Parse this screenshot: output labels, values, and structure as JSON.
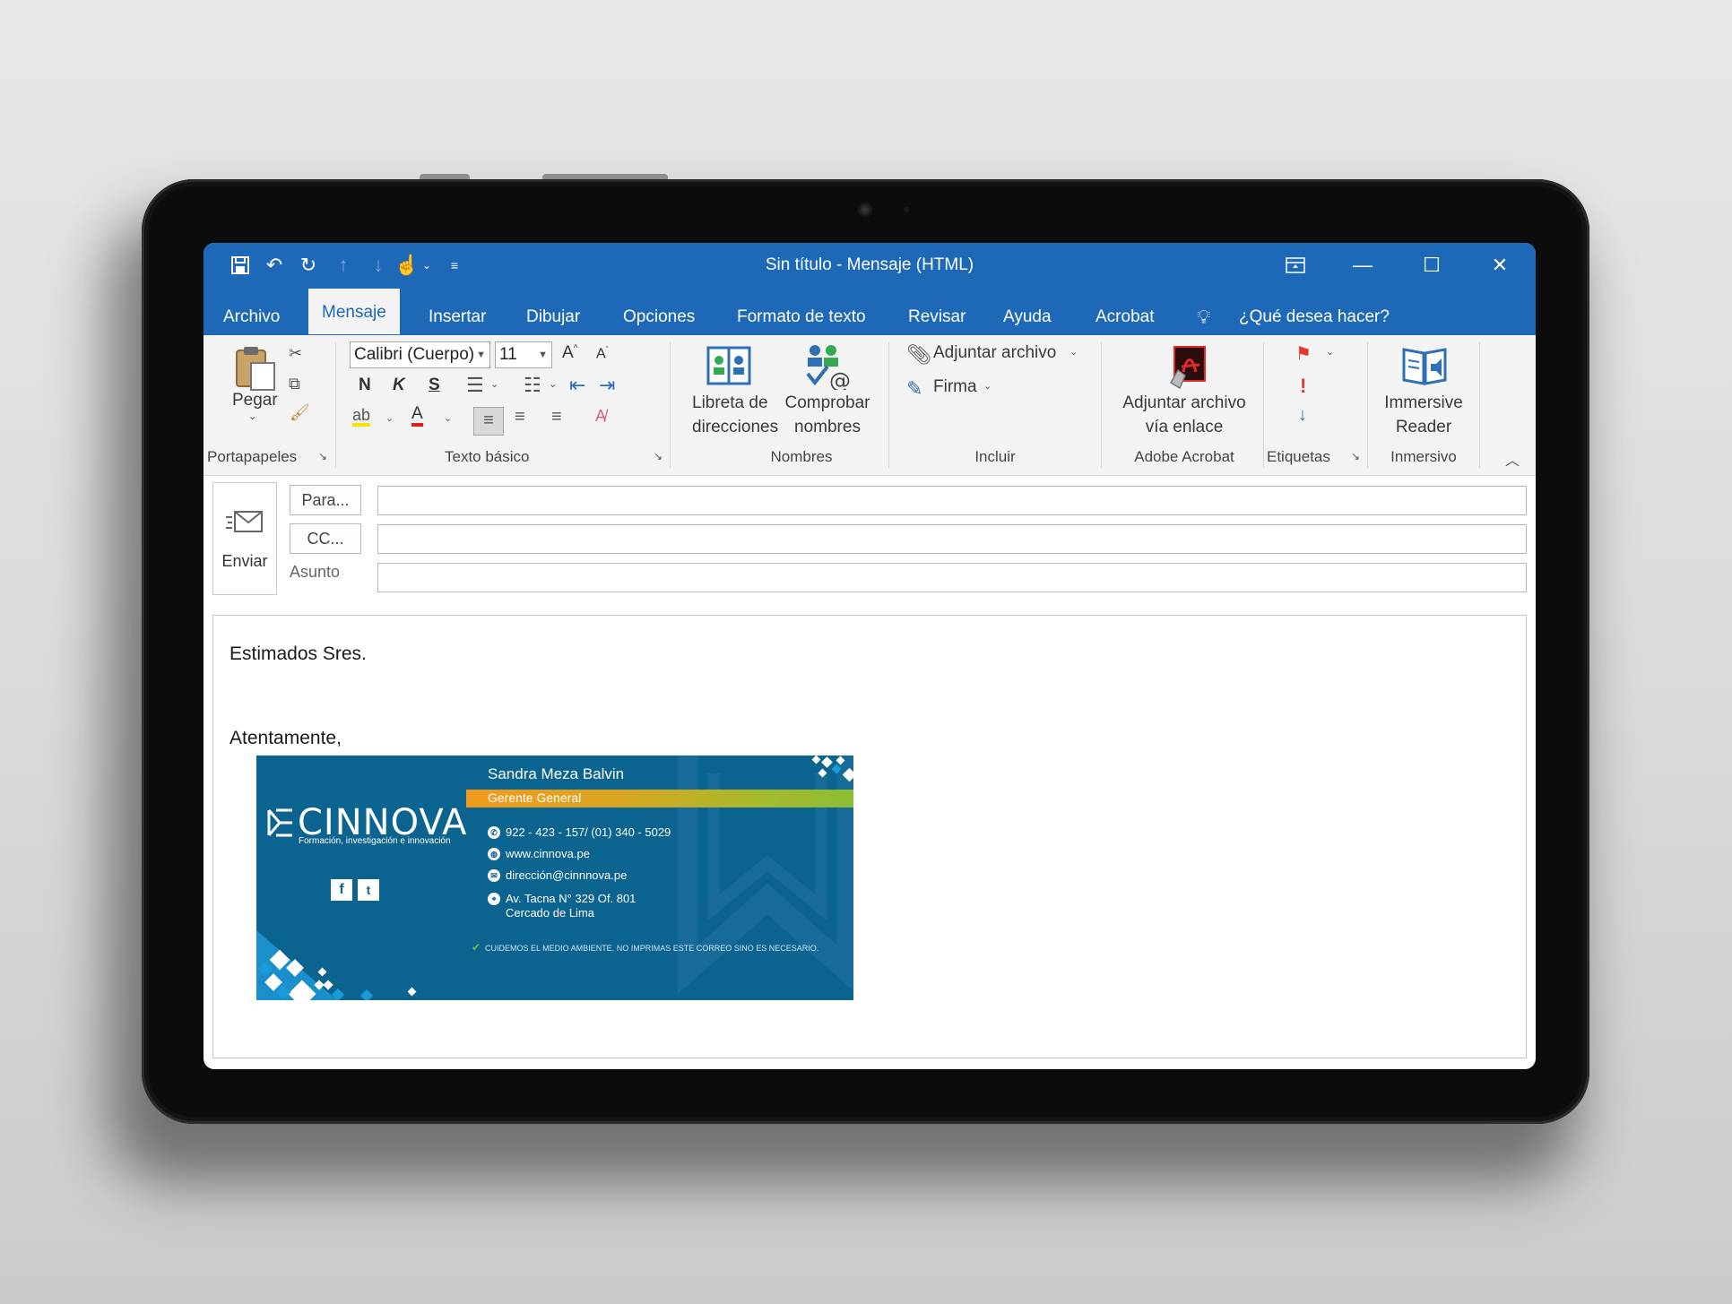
{
  "window": {
    "title": "Sin título  -  Mensaje (HTML)"
  },
  "tabs": [
    "Archivo",
    "Mensaje",
    "Insertar",
    "Dibujar",
    "Opciones",
    "Formato de texto",
    "Revisar",
    "Ayuda",
    "Acrobat"
  ],
  "active_tab": "Mensaje",
  "tell_me": "¿Qué desea hacer?",
  "ribbon": {
    "paste": "Pegar",
    "font_name": "Calibri (Cuerpo)",
    "font_size": "11",
    "bold": "N",
    "italic": "K",
    "underline": "S",
    "address_book": [
      "Libreta de",
      "direcciones"
    ],
    "check_names": [
      "Comprobar",
      "nombres"
    ],
    "attach_file": "Adjuntar archivo",
    "signature": "Firma",
    "attach_via_link": [
      "Adjuntar archivo",
      "vía enlace"
    ],
    "immersive_reader": [
      "Immersive",
      "Reader"
    ],
    "groups": {
      "clipboard": "Portapapeles",
      "basic_text": "Texto básico",
      "names": "Nombres",
      "include": "Incluir",
      "adobe": "Adobe Acrobat",
      "tags": "Etiquetas",
      "immersive": "Inmersivo"
    }
  },
  "compose": {
    "send": "Enviar",
    "to": "Para...",
    "cc": "CC...",
    "subject_label": "Asunto",
    "to_value": "",
    "cc_value": "",
    "subject_value": ""
  },
  "body": {
    "greeting": "Estimados Sres.",
    "closing": "Atentamente,"
  },
  "signature_card": {
    "logo": "CINNOVA",
    "tagline": "Formación, investigación e innovación",
    "name": "Sandra Meza Balvin",
    "role": "Gerente General",
    "phone": "922 - 423 - 157/ (01) 340 - 5029",
    "web": "www.cinnova.pe",
    "email": "dirección@cinnnova.pe",
    "address_line1": "Av. Tacna N° 329 Of. 801",
    "address_line2": "Cercado de Lima",
    "eco_note": "CUIDEMOS EL MEDIO AMBIENTE. NO IMPRIMAS ESTE CORREO SINO ES NECESARIO.",
    "social": [
      "f",
      "t"
    ],
    "colors": {
      "background": "#0b638f",
      "accent_start": "#f29a1e",
      "accent_end": "#8bbd34"
    }
  },
  "colors": {
    "titlebar": "#1d68b7",
    "ribbon": "#f3f3f3"
  }
}
